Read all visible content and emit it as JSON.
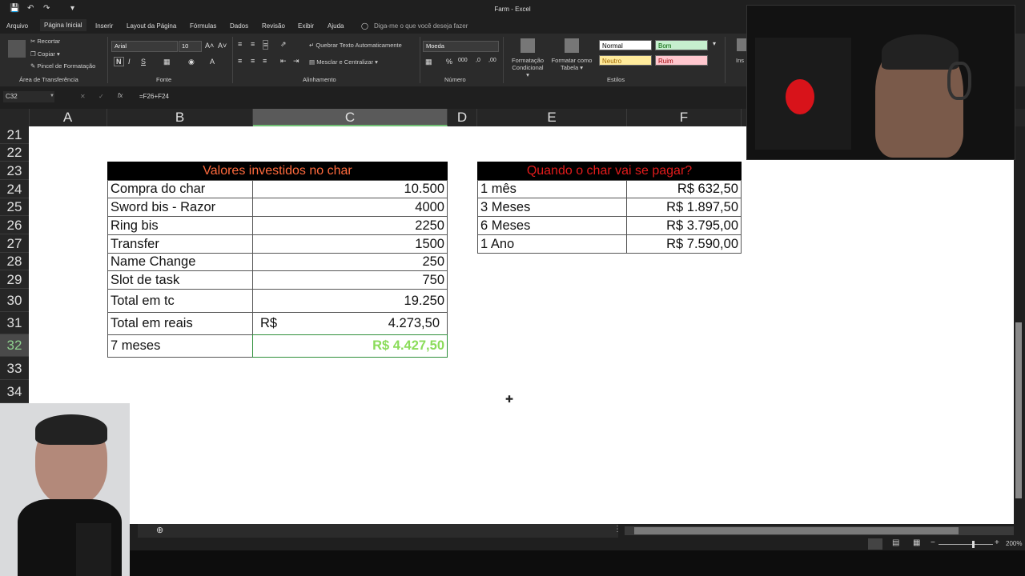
{
  "window": {
    "title": "Farm  -  Excel"
  },
  "tabs": [
    "Arquivo",
    "Página Inicial",
    "Inserir",
    "Layout da Página",
    "Fórmulas",
    "Dados",
    "Revisão",
    "Exibir",
    "Ajuda"
  ],
  "tell_me": "Diga-me o que você deseja fazer",
  "ribbon": {
    "clipboard": {
      "cut": "Recortar",
      "copy": "Copiar",
      "format_painter": "Pincel de Formatação",
      "title": "Área de Transferência"
    },
    "font": {
      "name": "Arial",
      "size": "10",
      "title": "Fonte"
    },
    "alignment": {
      "wrap": "Quebrar Texto Automaticamente",
      "merge": "Mesclar e Centralizar",
      "title": "Alinhamento"
    },
    "number": {
      "format": "Moeda",
      "title": "Número"
    },
    "styles": {
      "conditional_1": "Formatação",
      "conditional_2": "Condicional",
      "table_1": "Formatar como",
      "table_2": "Tabela",
      "normal": "Normal",
      "bom": "Bom",
      "neutro": "Neutro",
      "ruim": "Ruim",
      "title": "Estilos"
    },
    "insert_cut": "Ins"
  },
  "formula_bar": {
    "name_box": "C32",
    "formula": "=F26+F24"
  },
  "columns": [
    "A",
    "B",
    "C",
    "D",
    "E",
    "F"
  ],
  "rows": [
    "21",
    "22",
    "23",
    "24",
    "25",
    "26",
    "27",
    "28",
    "29",
    "30",
    "31",
    "32",
    "33",
    "34"
  ],
  "table1": {
    "header": "Valores investidos no char",
    "rows": [
      {
        "label": "Compra do char",
        "value": "10.500"
      },
      {
        "label": "Sword bis - Razor",
        "value": "4000"
      },
      {
        "label": "Ring bis",
        "value": "2250"
      },
      {
        "label": "Transfer",
        "value": "1500"
      },
      {
        "label": "Name Change",
        "value": "250"
      },
      {
        "label": "Slot de task",
        "value": "750"
      },
      {
        "label": "Total em tc",
        "value": "19.250"
      }
    ],
    "reais_label": "Total em reais",
    "reais_currency": "R$",
    "reais_value": "4.273,50",
    "months_label": "7 meses",
    "months_value": "R$ 4.427,50"
  },
  "table2": {
    "header": "Quando o char vai se pagar?",
    "rows": [
      {
        "label": "1 mês",
        "value": "R$ 632,50"
      },
      {
        "label": "3 Meses",
        "value": "R$ 1.897,50"
      },
      {
        "label": "6 Meses",
        "value": "R$ 3.795,00"
      },
      {
        "label": "1 Ano",
        "value": "R$ 7.590,00"
      }
    ]
  },
  "status": {
    "zoom": "200%"
  },
  "colors": {
    "header_bg": "#000000",
    "header_orange": "#ff6a3d",
    "header_red": "#e21b1b",
    "total_green": "#8bdc5a",
    "selected_col": "#5a5a5a"
  }
}
